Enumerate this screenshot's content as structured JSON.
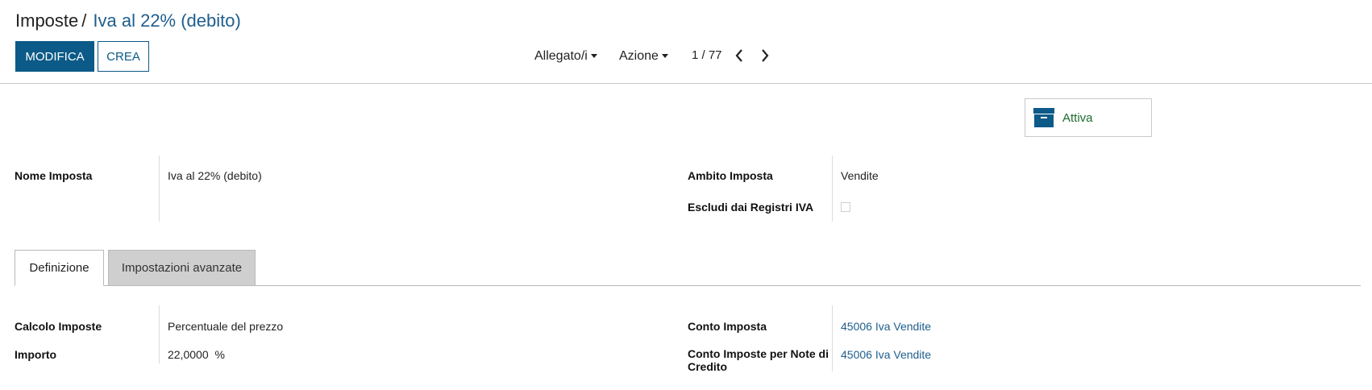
{
  "breadcrumb": {
    "parent": "Imposte",
    "separator": "/",
    "current": "Iva al 22% (debito)"
  },
  "toolbar": {
    "edit_label": "MODIFICA",
    "create_label": "CREA",
    "attachments_label": "Allegato/i",
    "action_label": "Azione",
    "pager": "1 / 77"
  },
  "smart_button": {
    "label": "Attiva",
    "icon": "archive-box-icon"
  },
  "form": {
    "tax_name": {
      "label": "Nome Imposta",
      "value": "Iva al 22% (debito)"
    },
    "tax_scope": {
      "label": "Ambito Imposta",
      "value": "Vendite"
    },
    "exclude_vat": {
      "label": "Escludi dai Registri IVA",
      "checked": false
    }
  },
  "tabs": [
    {
      "label": "Definizione",
      "active": true
    },
    {
      "label": "Impostazioni avanzate",
      "active": false
    }
  ],
  "definition": {
    "computation": {
      "label": "Calcolo Imposte",
      "value": "Percentuale del prezzo"
    },
    "amount": {
      "label": "Importo",
      "value": "22,0000",
      "unit": "%"
    },
    "tax_account": {
      "label": "Conto Imposta",
      "value": "45006 Iva Vendite"
    },
    "refund_account": {
      "label_line1": "Conto Imposte per Note di",
      "label_line2": "Credito",
      "value": "45006 Iva Vendite"
    }
  },
  "colors": {
    "primary": "#0b5a87",
    "link": "#1f5e8c",
    "active_green": "#1d6b2e"
  }
}
